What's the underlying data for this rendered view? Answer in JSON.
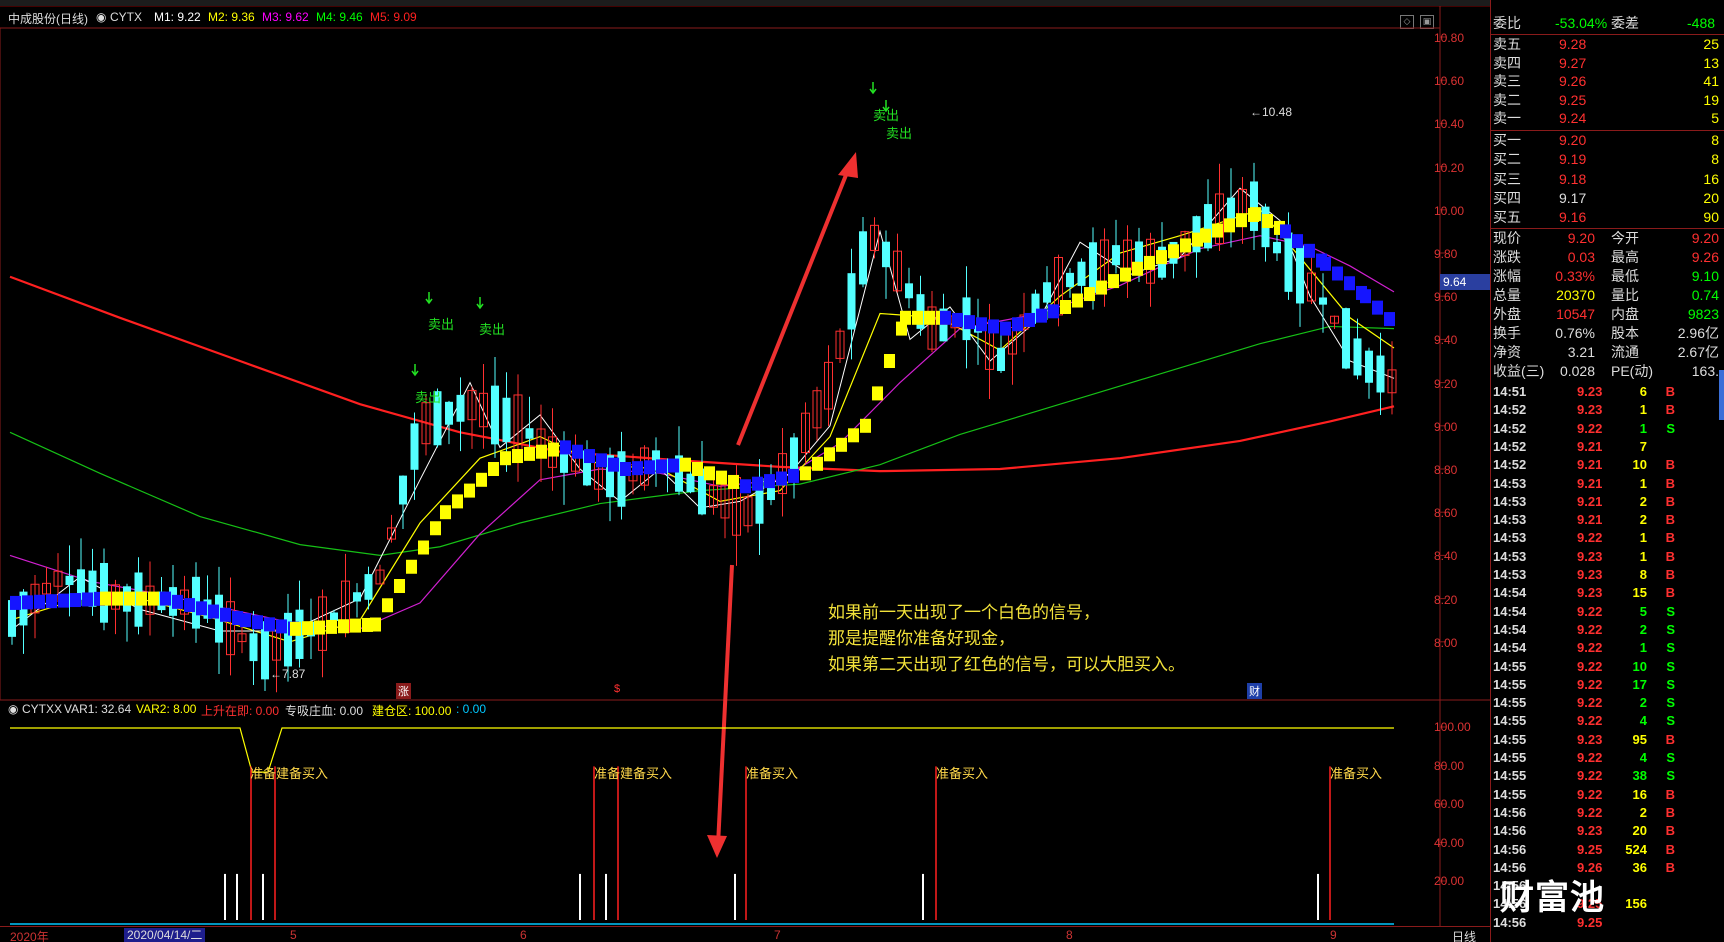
{
  "main_chart": {
    "stock_name": "中成股份(日线)",
    "indicator_name": "CYTX",
    "ma_labels": [
      {
        "text": "M1: 9.22",
        "color": "#ffffff"
      },
      {
        "text": "M2: 9.36",
        "color": "#ffff00"
      },
      {
        "text": "M3: 9.62",
        "color": "#ff00ff"
      },
      {
        "text": "M4: 9.46",
        "color": "#00ff00"
      },
      {
        "text": "M5: 9.09",
        "color": "#ff2020"
      }
    ],
    "y_axis_labels": [
      "10.80",
      "10.60",
      "10.40",
      "10.20",
      "10.00",
      "9.80",
      "9.60",
      "9.40",
      "9.20",
      "9.00",
      "8.80",
      "8.60",
      "8.40",
      "8.20",
      "8.00"
    ],
    "current_price_tag": "9.64",
    "high_marker": "10.48",
    "low_marker": "7.87",
    "sell_signal_label": "卖出",
    "event_markers": [
      {
        "text": "涨",
        "color": "#ff3030"
      },
      {
        "text": "$",
        "color": "#ff3030"
      },
      {
        "text": "财",
        "color": "#3070ff"
      }
    ]
  },
  "annotation": {
    "lines": [
      "如果前一天出现了一个白色的信号，",
      "那是提醒你准备好现金，",
      "如果第二天出现了红色的信号，可以大胆买入。"
    ]
  },
  "sub_chart": {
    "indicator_name": "CYTXX",
    "var_labels": [
      {
        "text": "VAR1: 32.64",
        "color": "#dddddd"
      },
      {
        "text": "VAR2: 8.00",
        "color": "#ffff00"
      },
      {
        "text": "上升在即: 0.00",
        "color": "#ff3030"
      },
      {
        "text": "专吸庄血: 0.00",
        "color": "#dddddd"
      },
      {
        "text": "建仓区: 100.00",
        "color": "#ffff00"
      },
      {
        "text": ": 0.00",
        "color": "#00c8ff"
      }
    ],
    "y_axis_labels": [
      "100.00",
      "80.00",
      "60.00",
      "40.00",
      "20.00"
    ],
    "signal_labels": [
      "准备建备买入",
      "准备建备买入",
      "准备买入",
      "准备买入",
      "准备买入"
    ]
  },
  "date_axis": {
    "labels": [
      {
        "text": "2020年"
      },
      {
        "text": "5"
      },
      {
        "text": "6"
      },
      {
        "text": "7"
      },
      {
        "text": "8"
      },
      {
        "text": "9"
      }
    ],
    "selected_date": "2020/04/14/二",
    "period": "日线"
  },
  "quote_panel": {
    "weibi": {
      "label": "委比",
      "value": "-53.04%",
      "diff_label": "委差",
      "diff_value": "-488"
    },
    "asks": [
      {
        "label": "卖五",
        "price": "9.28",
        "vol": "25"
      },
      {
        "label": "卖四",
        "price": "9.27",
        "vol": "13"
      },
      {
        "label": "卖三",
        "price": "9.26",
        "vol": "41"
      },
      {
        "label": "卖二",
        "price": "9.25",
        "vol": "19"
      },
      {
        "label": "卖一",
        "price": "9.24",
        "vol": "5"
      }
    ],
    "bids": [
      {
        "label": "买一",
        "price": "9.20",
        "vol": "8"
      },
      {
        "label": "买二",
        "price": "9.19",
        "vol": "8"
      },
      {
        "label": "买三",
        "price": "9.18",
        "vol": "16"
      },
      {
        "label": "买四",
        "price": "9.17",
        "vol": "20"
      },
      {
        "label": "买五",
        "price": "9.16",
        "vol": "90"
      }
    ],
    "stats": [
      {
        "l1": "现价",
        "v1": "9.20",
        "c1": "#ff3030",
        "l2": "今开",
        "v2": "9.20",
        "c2": "#ff3030"
      },
      {
        "l1": "涨跌",
        "v1": "0.03",
        "c1": "#ff3030",
        "l2": "最高",
        "v2": "9.26",
        "c2": "#ff3030"
      },
      {
        "l1": "涨幅",
        "v1": "0.33%",
        "c1": "#ff3030",
        "l2": "最低",
        "v2": "9.10",
        "c2": "#00ff00"
      },
      {
        "l1": "总量",
        "v1": "20370",
        "c1": "#ffff00",
        "l2": "量比",
        "v2": "0.74",
        "c2": "#00ff00"
      },
      {
        "l1": "外盘",
        "v1": "10547",
        "c1": "#ff3030",
        "l2": "内盘",
        "v2": "9823",
        "c2": "#00ff00"
      },
      {
        "l1": "换手",
        "v1": "0.76%",
        "c1": "#dddddd",
        "l2": "股本",
        "v2": "2.96亿",
        "c2": "#dddddd"
      },
      {
        "l1": "净资",
        "v1": "3.21",
        "c1": "#dddddd",
        "l2": "流通",
        "v2": "2.67亿",
        "c2": "#dddddd"
      },
      {
        "l1": "收益(三)",
        "v1": "0.028",
        "c1": "#dddddd",
        "l2": "PE(动)",
        "v2": "163.",
        "c2": "#dddddd"
      }
    ],
    "ticks": [
      {
        "t": "14:51",
        "p": "9.23",
        "v": "6",
        "d": "B"
      },
      {
        "t": "14:52",
        "p": "9.23",
        "v": "1",
        "d": "B"
      },
      {
        "t": "14:52",
        "p": "9.22",
        "v": "1",
        "d": "S"
      },
      {
        "t": "14:52",
        "p": "9.21",
        "v": "7",
        "d": ""
      },
      {
        "t": "14:52",
        "p": "9.21",
        "v": "10",
        "d": "B"
      },
      {
        "t": "14:53",
        "p": "9.21",
        "v": "1",
        "d": "B"
      },
      {
        "t": "14:53",
        "p": "9.21",
        "v": "2",
        "d": "B"
      },
      {
        "t": "14:53",
        "p": "9.21",
        "v": "2",
        "d": "B"
      },
      {
        "t": "14:53",
        "p": "9.22",
        "v": "1",
        "d": "B"
      },
      {
        "t": "14:53",
        "p": "9.23",
        "v": "1",
        "d": "B"
      },
      {
        "t": "14:53",
        "p": "9.23",
        "v": "8",
        "d": "B"
      },
      {
        "t": "14:54",
        "p": "9.23",
        "v": "15",
        "d": "B"
      },
      {
        "t": "14:54",
        "p": "9.22",
        "v": "5",
        "d": "S"
      },
      {
        "t": "14:54",
        "p": "9.22",
        "v": "2",
        "d": "S"
      },
      {
        "t": "14:54",
        "p": "9.22",
        "v": "1",
        "d": "S"
      },
      {
        "t": "14:55",
        "p": "9.22",
        "v": "10",
        "d": "S"
      },
      {
        "t": "14:55",
        "p": "9.22",
        "v": "17",
        "d": "S"
      },
      {
        "t": "14:55",
        "p": "9.22",
        "v": "2",
        "d": "S"
      },
      {
        "t": "14:55",
        "p": "9.22",
        "v": "4",
        "d": "S"
      },
      {
        "t": "14:55",
        "p": "9.23",
        "v": "95",
        "d": "B"
      },
      {
        "t": "14:55",
        "p": "9.22",
        "v": "4",
        "d": "S"
      },
      {
        "t": "14:55",
        "p": "9.22",
        "v": "38",
        "d": "S"
      },
      {
        "t": "14:55",
        "p": "9.22",
        "v": "16",
        "d": "B"
      },
      {
        "t": "14:56",
        "p": "9.22",
        "v": "2",
        "d": "B"
      },
      {
        "t": "14:56",
        "p": "9.23",
        "v": "20",
        "d": "B"
      },
      {
        "t": "14:56",
        "p": "9.25",
        "v": "524",
        "d": "B"
      },
      {
        "t": "14:56",
        "p": "9.26",
        "v": "36",
        "d": "B"
      },
      {
        "t": "14:56",
        "p": "",
        "v": "",
        "d": ""
      },
      {
        "t": "14:56",
        "p": "9.25",
        "v": "156",
        "d": ""
      },
      {
        "t": "14:56",
        "p": "9.25",
        "v": "",
        "d": ""
      }
    ]
  },
  "watermark": "财富池"
}
